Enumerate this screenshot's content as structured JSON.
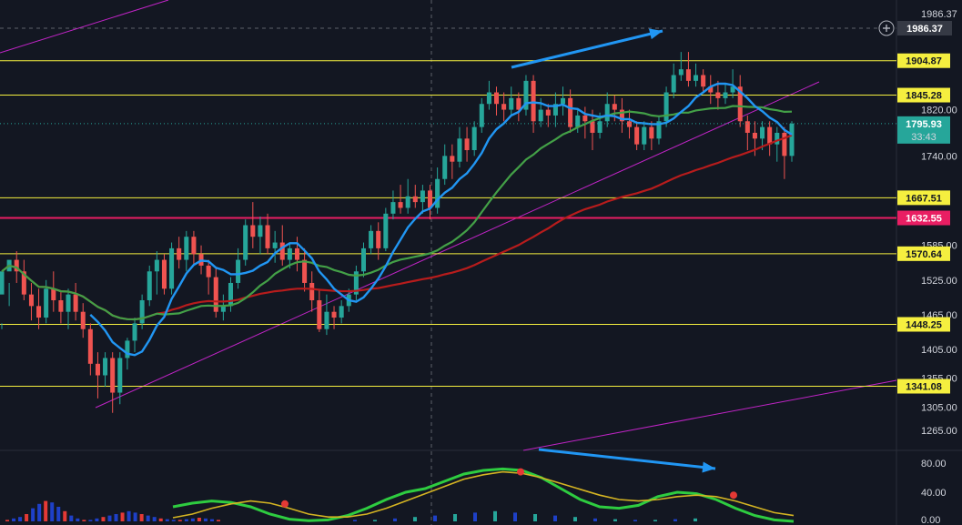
{
  "chart_data": [
    {
      "type": "candlestick",
      "title": "",
      "y_axis_ticks": [
        1986.37,
        1820.0,
        1740.0,
        1585.0,
        1525.0,
        1465.0,
        1405.0,
        1355.0,
        1305.0,
        1265.0
      ],
      "ylim": [
        1230,
        2010
      ],
      "grid": false,
      "last_price": {
        "value": "1795.93",
        "countdown": "33:43"
      },
      "crosshair_price": "1986.37",
      "horizontal_levels": [
        {
          "value": 1904.87,
          "label": "1904.87",
          "color": "#f5ef3f",
          "style": "yellow"
        },
        {
          "value": 1845.28,
          "label": "1845.28",
          "color": "#f5ef3f",
          "style": "yellow"
        },
        {
          "value": 1667.51,
          "label": "1667.51",
          "color": "#f5ef3f",
          "style": "yellow"
        },
        {
          "value": 1632.55,
          "label": "1632.55",
          "color": "#e91e63",
          "style": "pink"
        },
        {
          "value": 1570.64,
          "label": "1570.64",
          "color": "#f5ef3f",
          "style": "yellow"
        },
        {
          "value": 1448.25,
          "label": "1448.25",
          "color": "#f5ef3f",
          "style": "yellow"
        },
        {
          "value": 1341.08,
          "label": "1341.08",
          "color": "#f5ef3f",
          "style": "yellow"
        }
      ],
      "candles": [
        [
          1500,
          1540,
          1450,
          1440
        ],
        [
          1540,
          1560,
          1520,
          1480
        ],
        [
          1560,
          1540,
          1575,
          1520
        ],
        [
          1540,
          1500,
          1560,
          1490
        ],
        [
          1500,
          1480,
          1520,
          1455
        ],
        [
          1480,
          1460,
          1510,
          1440
        ],
        [
          1460,
          1510,
          1525,
          1450
        ],
        [
          1510,
          1490,
          1540,
          1470
        ],
        [
          1490,
          1470,
          1505,
          1450
        ],
        [
          1470,
          1500,
          1510,
          1440
        ],
        [
          1500,
          1470,
          1520,
          1455
        ],
        [
          1470,
          1440,
          1485,
          1425
        ],
        [
          1440,
          1380,
          1450,
          1360
        ],
        [
          1380,
          1360,
          1400,
          1320
        ],
        [
          1360,
          1390,
          1400,
          1340
        ],
        [
          1390,
          1330,
          1400,
          1295
        ],
        [
          1330,
          1390,
          1400,
          1310
        ],
        [
          1390,
          1420,
          1425,
          1370
        ],
        [
          1420,
          1450,
          1460,
          1400
        ],
        [
          1450,
          1490,
          1500,
          1440
        ],
        [
          1490,
          1540,
          1550,
          1480
        ],
        [
          1540,
          1560,
          1575,
          1500
        ],
        [
          1560,
          1510,
          1570,
          1500
        ],
        [
          1510,
          1580,
          1590,
          1500
        ],
        [
          1580,
          1560,
          1600,
          1545
        ],
        [
          1560,
          1600,
          1610,
          1540
        ],
        [
          1600,
          1570,
          1610,
          1550
        ],
        [
          1570,
          1550,
          1585,
          1535
        ],
        [
          1550,
          1530,
          1560,
          1500
        ],
        [
          1530,
          1470,
          1545,
          1460
        ],
        [
          1470,
          1480,
          1500,
          1455
        ],
        [
          1480,
          1520,
          1530,
          1470
        ],
        [
          1520,
          1560,
          1580,
          1510
        ],
        [
          1560,
          1620,
          1630,
          1550
        ],
        [
          1620,
          1600,
          1660,
          1580
        ],
        [
          1600,
          1620,
          1635,
          1570
        ],
        [
          1620,
          1580,
          1640,
          1570
        ],
        [
          1580,
          1590,
          1610,
          1555
        ],
        [
          1590,
          1560,
          1620,
          1550
        ],
        [
          1560,
          1580,
          1590,
          1545
        ],
        [
          1580,
          1560,
          1600,
          1540
        ],
        [
          1560,
          1520,
          1580,
          1505
        ],
        [
          1520,
          1490,
          1540,
          1470
        ],
        [
          1490,
          1440,
          1510,
          1435
        ],
        [
          1440,
          1470,
          1500,
          1430
        ],
        [
          1470,
          1460,
          1480,
          1440
        ],
        [
          1460,
          1480,
          1490,
          1450
        ],
        [
          1480,
          1500,
          1510,
          1470
        ],
        [
          1500,
          1540,
          1550,
          1490
        ],
        [
          1540,
          1580,
          1590,
          1530
        ],
        [
          1580,
          1610,
          1620,
          1570
        ],
        [
          1610,
          1580,
          1625,
          1560
        ],
        [
          1580,
          1640,
          1650,
          1575
        ],
        [
          1640,
          1660,
          1680,
          1630
        ],
        [
          1660,
          1650,
          1690,
          1640
        ],
        [
          1650,
          1670,
          1700,
          1640
        ],
        [
          1670,
          1660,
          1690,
          1650
        ],
        [
          1660,
          1680,
          1690,
          1640
        ],
        [
          1680,
          1650,
          1690,
          1630
        ],
        [
          1650,
          1700,
          1720,
          1640
        ],
        [
          1700,
          1740,
          1760,
          1690
        ],
        [
          1740,
          1730,
          1760,
          1700
        ],
        [
          1730,
          1770,
          1790,
          1720
        ],
        [
          1770,
          1750,
          1790,
          1730
        ],
        [
          1750,
          1790,
          1800,
          1740
        ],
        [
          1790,
          1830,
          1840,
          1780
        ],
        [
          1830,
          1850,
          1870,
          1820
        ],
        [
          1850,
          1830,
          1860,
          1810
        ],
        [
          1830,
          1820,
          1850,
          1800
        ],
        [
          1820,
          1840,
          1860,
          1810
        ],
        [
          1840,
          1820,
          1850,
          1800
        ],
        [
          1820,
          1870,
          1880,
          1810
        ],
        [
          1870,
          1800,
          1880,
          1780
        ],
        [
          1800,
          1820,
          1840,
          1790
        ],
        [
          1820,
          1810,
          1830,
          1790
        ],
        [
          1810,
          1830,
          1850,
          1790
        ],
        [
          1830,
          1840,
          1860,
          1810
        ],
        [
          1840,
          1790,
          1855,
          1780
        ],
        [
          1790,
          1810,
          1820,
          1780
        ],
        [
          1810,
          1800,
          1825,
          1770
        ],
        [
          1800,
          1780,
          1820,
          1750
        ],
        [
          1780,
          1800,
          1815,
          1770
        ],
        [
          1800,
          1830,
          1850,
          1790
        ],
        [
          1830,
          1820,
          1845,
          1800
        ],
        [
          1820,
          1800,
          1840,
          1780
        ],
        [
          1800,
          1790,
          1820,
          1770
        ],
        [
          1790,
          1760,
          1800,
          1750
        ],
        [
          1760,
          1790,
          1800,
          1750
        ],
        [
          1790,
          1770,
          1800,
          1750
        ],
        [
          1770,
          1800,
          1810,
          1760
        ],
        [
          1800,
          1850,
          1860,
          1790
        ],
        [
          1850,
          1880,
          1900,
          1840
        ],
        [
          1880,
          1890,
          1920,
          1870
        ],
        [
          1890,
          1870,
          1920,
          1860
        ],
        [
          1870,
          1880,
          1900,
          1860
        ],
        [
          1880,
          1860,
          1890,
          1850
        ],
        [
          1860,
          1850,
          1880,
          1830
        ],
        [
          1850,
          1840,
          1870,
          1820
        ],
        [
          1840,
          1850,
          1865,
          1830
        ],
        [
          1850,
          1860,
          1890,
          1840
        ],
        [
          1860,
          1800,
          1880,
          1790
        ],
        [
          1800,
          1780,
          1810,
          1750
        ],
        [
          1780,
          1770,
          1800,
          1740
        ],
        [
          1770,
          1790,
          1800,
          1750
        ],
        [
          1790,
          1760,
          1800,
          1740
        ],
        [
          1760,
          1780,
          1790,
          1730
        ],
        [
          1780,
          1740,
          1790,
          1700
        ],
        [
          1740,
          1795.93,
          1800,
          1730
        ]
      ]
    },
    {
      "type": "line",
      "title": "",
      "y_axis_ticks": [
        80.0,
        40.0,
        0.0
      ],
      "ylim": [
        -5,
        95
      ],
      "series": [
        {
          "color": "#2ecc40",
          "values": [
            20,
            25,
            28,
            26,
            20,
            10,
            3,
            1,
            2,
            8,
            18,
            30,
            40,
            45,
            55,
            65,
            70,
            72,
            70,
            60,
            45,
            30,
            20,
            18,
            22,
            34,
            40,
            38,
            30,
            18,
            8,
            2,
            0
          ]
        },
        {
          "color": "#d4b422",
          "values": [
            5,
            10,
            18,
            24,
            28,
            25,
            18,
            10,
            6,
            6,
            10,
            18,
            28,
            38,
            48,
            58,
            64,
            68,
            66,
            60,
            52,
            44,
            36,
            30,
            28,
            30,
            34,
            36,
            34,
            28,
            20,
            12,
            8
          ]
        }
      ],
      "histogram": [
        2,
        4,
        6,
        10,
        18,
        24,
        28,
        26,
        20,
        14,
        8,
        4,
        2,
        2,
        4,
        6,
        8,
        10,
        12,
        14,
        12,
        10,
        8,
        6,
        4,
        3,
        2,
        2,
        3,
        4,
        5,
        4,
        3,
        2
      ]
    }
  ]
}
